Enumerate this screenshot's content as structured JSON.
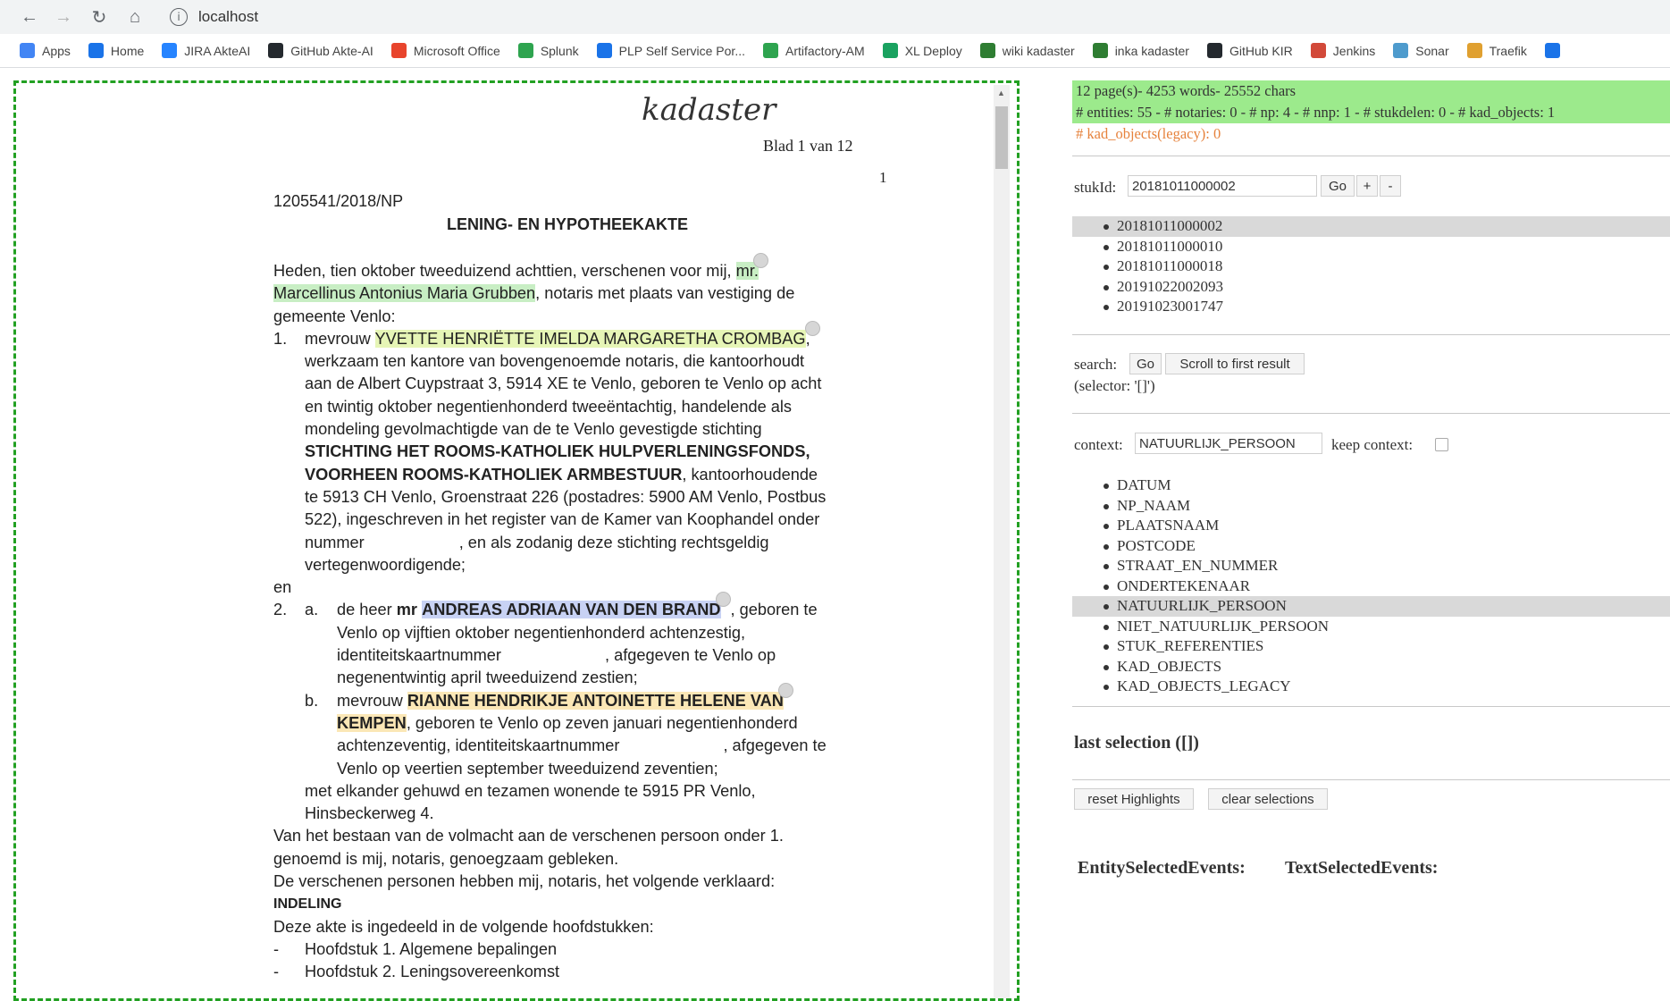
{
  "browser": {
    "url": "localhost",
    "bookmarks": [
      {
        "label": "Apps",
        "icon": "apps-grid-icon",
        "color": "#4285f4"
      },
      {
        "label": "Home",
        "icon": "home-logo-icon",
        "color": "#1a73e8"
      },
      {
        "label": "JIRA AkteAI",
        "icon": "jira-icon",
        "color": "#2684ff"
      },
      {
        "label": "GitHub Akte-AI",
        "icon": "github-icon",
        "color": "#24292e"
      },
      {
        "label": "Microsoft Office",
        "icon": "office-icon",
        "color": "#e8442c"
      },
      {
        "label": "Splunk",
        "icon": "splunk-icon",
        "color": "#2ea44f"
      },
      {
        "label": "PLP Self Service Por...",
        "icon": "globe-icon",
        "color": "#1a73e8"
      },
      {
        "label": "Artifactory-AM",
        "icon": "artifactory-icon",
        "color": "#2ea44f"
      },
      {
        "label": "XL Deploy",
        "icon": "xl-deploy-icon",
        "color": "#1aa260"
      },
      {
        "label": "wiki kadaster",
        "icon": "pin-icon",
        "color": "#2e7d32"
      },
      {
        "label": "inka kadaster",
        "icon": "pin-icon",
        "color": "#2e7d32"
      },
      {
        "label": "GitHub KIR",
        "icon": "github-icon",
        "color": "#24292e"
      },
      {
        "label": "Jenkins",
        "icon": "jenkins-icon",
        "color": "#d24939"
      },
      {
        "label": "Sonar",
        "icon": "sonar-icon",
        "color": "#4e9bcd"
      },
      {
        "label": "Traefik",
        "icon": "traefik-icon",
        "color": "#e0a030"
      },
      {
        "label": "",
        "icon": "globe-icon",
        "color": "#1a73e8"
      }
    ]
  },
  "document": {
    "logo": "kadaster",
    "page_label": "Blad 1 van 12",
    "page_number": "1",
    "reference": "1205541/2018/NP",
    "title": "LENING- EN HYPOTHEEKAKTE",
    "l1": "Heden, tien oktober tweeduizend achttien, verschenen voor mij,",
    "l1_hl": "mr.",
    "l2_hl": "Marcellinus Antonius Maria Grubben",
    "l2": ", notaris met plaats van vestiging de",
    "l3": "gemeente Venlo:",
    "l4_num": "1.",
    "l4_pre": "mevrouw",
    "l4_hl": "YVETTE HENRIËTTE IMELDA MARGARETHA CROMBAG",
    "l4_post": ",",
    "l5": "werkzaam ten kantore van bovengenoemde notaris, die kantoorhoudt",
    "l6": "aan de Albert Cuypstraat 3, 5914 XE te Venlo, geboren te Venlo op acht",
    "l7": "en twintig oktober negentienhonderd tweeëntachtig, handelende als",
    "l8": "mondeling gevolmachtigde van de te Venlo gevestigde stichting",
    "l9": "STICHTING HET ROOMS-KATHOLIEK HULPVERLENINGSFONDS,",
    "l10_b": "VOORHEEN ROOMS-KATHOLIEK ARMBESTUUR",
    "l10": ", kantoorhoudende",
    "l11": "te 5913 CH Venlo, Groenstraat 226 (postadres: 5900 AM Venlo, Postbus",
    "l12": "522), ingeschreven in het register van de Kamer van Koophandel onder",
    "l13a": "nummer",
    "l13b": ", en als zodanig deze stichting rechtsgeldig",
    "l14": "vertegenwoordigende;",
    "l15": "en",
    "l16_num": "2.",
    "l16_sub": "a.",
    "l16_pre": "de heer",
    "l16_b": "mr",
    "l16_hl": "ANDREAS ADRIAAN VAN DEN BRAND",
    "l16_post": ", geboren te",
    "l17": "Venlo op vijftien oktober negentienhonderd achtenzestig,",
    "l18a": "identiteitskaartnummer",
    "l18b": ", afgegeven te Venlo op",
    "l19": "negenentwintig april tweeduizend zestien;",
    "l20_sub": "b.",
    "l20_pre": "mevrouw",
    "l20_hl": "RIANNE HENDRIKJE ANTOINETTE HELENE VAN",
    "l21_hl": "KEMPEN",
    "l21": ", geboren te Venlo op zeven januari negentienhonderd",
    "l22a": "achtenzeventig, identiteitskaartnummer",
    "l22b": ", afgegeven te",
    "l23": "Venlo  op veertien september tweeduizend zeventien;",
    "l24": "met elkander gehuwd en tezamen wonende te 5915 PR Venlo,",
    "l25": "Hinsbeckerweg 4.",
    "l26": "Van het bestaan van de volmacht aan de verschenen persoon onder 1.",
    "l27": "genoemd is mij, notaris, genoegzaam gebleken.",
    "l28": "De verschenen personen hebben mij, notaris, het volgende verklaard:",
    "l29": "INDELING",
    "l30": "Deze akte is ingedeeld in de volgende hoofdstukken:",
    "l31_dash": "-",
    "l31": "Hoofdstuk 1. Algemene bepalingen",
    "l32_dash": "-",
    "l32": "Hoofdstuk 2. Leningsovereenkomst"
  },
  "panel": {
    "stats_line1": "12 page(s)- 4253 words- 25552 chars",
    "stats_line2": "# entities: 55 - # notaries: 0 - # np: 4 - # nnp: 1 - # stukdelen: 0 - # kad_objects: 1",
    "stats_line3": "# kad_objects(legacy): 0",
    "stukid_label": "stukId:",
    "stukid_value": "20181011000002",
    "go_label": "Go",
    "plus_label": "+",
    "minus_label": "-",
    "stuk_ids": [
      "20181011000002",
      "20181011000010",
      "20181011000018",
      "20191022002093",
      "20191023001747"
    ],
    "search_label": "search:",
    "search_go": "Go",
    "scroll_label": "Scroll to first result",
    "selector_text": "(selector: '[]')",
    "context_label": "context:",
    "context_value": "NATUURLIJK_PERSOON",
    "keep_context_label": "keep context:",
    "contexts": [
      "DATUM",
      "NP_NAAM",
      "PLAATSNAAM",
      "POSTCODE",
      "STRAAT_EN_NUMMER",
      "ONDERTEKENAAR",
      "NATUURLIJK_PERSOON",
      "NIET_NATUURLIJK_PERSOON",
      "STUK_REFERENTIES",
      "KAD_OBJECTS",
      "KAD_OBJECTS_LEGACY"
    ],
    "selected_context": "NATUURLIJK_PERSOON",
    "last_selection": "last selection ([])",
    "reset_label": "reset Highlights",
    "clear_label": "clear selections",
    "entity_events": "EntitySelectedEvents:",
    "text_events": "TextSelectedEvents:"
  }
}
